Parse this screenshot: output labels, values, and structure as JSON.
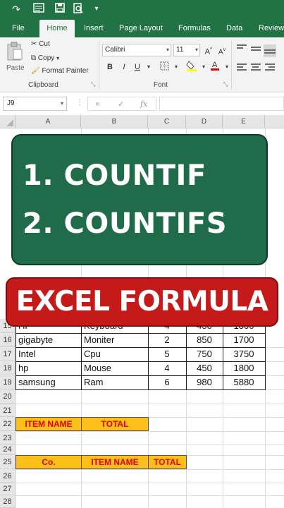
{
  "quick_access": {
    "redo_icon": "redo-icon",
    "form_icon": "form-icon",
    "save_icon": "save-icon",
    "print_preview_icon": "print-preview-icon",
    "customize_icon": "customize-icon"
  },
  "ribbon_tabs": [
    "File",
    "Home",
    "Insert",
    "Page Layout",
    "Formulas",
    "Data",
    "Review"
  ],
  "active_tab": "Home",
  "clipboard": {
    "paste_label": "Paste",
    "cut_label": "Cut",
    "copy_label": "Copy",
    "format_painter_label": "Format Painter",
    "group_label": "Clipboard"
  },
  "font": {
    "font_name": "Calibri",
    "font_size": "11",
    "bold": "B",
    "italic": "I",
    "underline": "U",
    "group_label": "Font"
  },
  "name_box": "J9",
  "formula_buttons": {
    "cancel": "×",
    "enter": "✓",
    "fx": "fx"
  },
  "columns": [
    "A",
    "B",
    "C",
    "D",
    "E"
  ],
  "rows": [
    {
      "num": "16",
      "a": "gigabyte",
      "b": "Moniter",
      "c": "2",
      "d": "850",
      "e": "1700"
    },
    {
      "num": "17",
      "a": "Intel",
      "b": "Cpu",
      "c": "5",
      "d": "750",
      "e": "3750"
    },
    {
      "num": "18",
      "a": "hp",
      "b": "Mouse",
      "c": "4",
      "d": "450",
      "e": "1800"
    },
    {
      "num": "19",
      "a": "samsung",
      "b": "Ram",
      "c": "6",
      "d": "980",
      "e": "5880"
    }
  ],
  "partial_row": {
    "num": "15",
    "a": "HP",
    "b": "Keyboard",
    "c": "4",
    "d": "450",
    "e": "1800"
  },
  "empty_rows": [
    "20",
    "21",
    "23",
    "24",
    "26",
    "27",
    "28"
  ],
  "row22": {
    "num": "22",
    "item_name": "ITEM NAME",
    "total": "TOTAL"
  },
  "row25": {
    "num": "25",
    "co": "Co.",
    "item_name": "ITEM NAME",
    "total": "TOTAL"
  },
  "overlay": {
    "line1": "1. COUNTIF",
    "line2": "2. COUNTIFS",
    "banner": "EXCEL FORMULA"
  },
  "colors": {
    "excel_green": "#217346",
    "card_green": "#1f6b4a",
    "banner_red": "#c41a1a",
    "header_yellow": "#fdbf1a",
    "header_text_red": "#e00000"
  }
}
